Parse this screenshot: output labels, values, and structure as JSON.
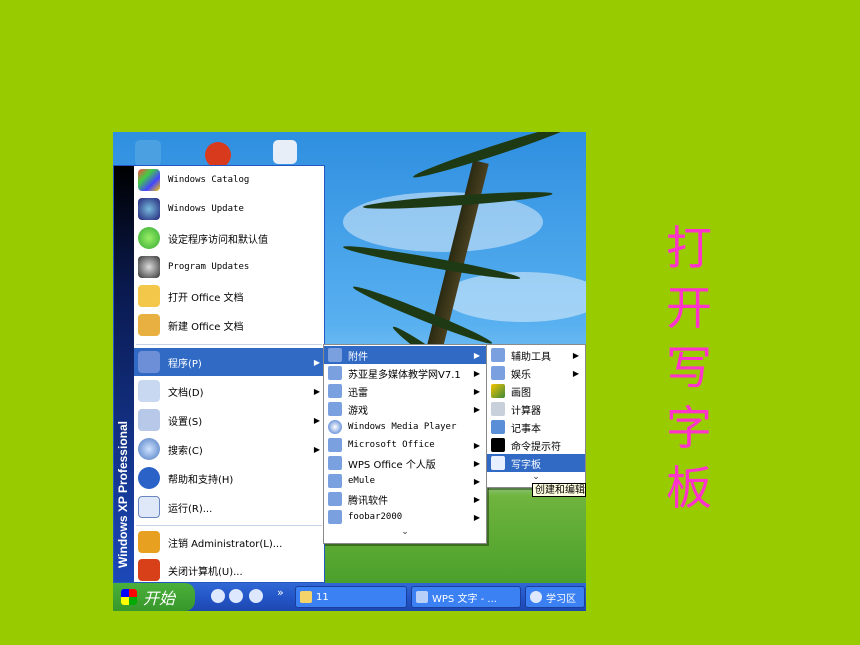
{
  "side_title_chars": [
    "打",
    "开",
    "写",
    "字",
    "板"
  ],
  "start_menu": {
    "band_text": "Windows XP Professional",
    "pinned": [
      {
        "label": "Windows Catalog",
        "icon": "windows-catalog-icon"
      },
      {
        "label": "Windows Update",
        "icon": "windows-update-icon"
      },
      {
        "label": "设定程序访问和默认值",
        "icon": "program-access-icon"
      },
      {
        "label": "Program Updates",
        "icon": "program-updates-icon"
      },
      {
        "label": "打开 Office 文档",
        "icon": "open-office-doc-icon"
      },
      {
        "label": "新建 Office 文档",
        "icon": "new-office-doc-icon"
      }
    ],
    "main": [
      {
        "label": "程序(P)",
        "icon": "programs-icon",
        "arrow": "▶"
      },
      {
        "label": "文档(D)",
        "icon": "documents-icon",
        "arrow": "▶"
      },
      {
        "label": "设置(S)",
        "icon": "settings-icon",
        "arrow": "▶"
      },
      {
        "label": "搜索(C)",
        "icon": "search-icon",
        "arrow": "▶"
      },
      {
        "label": "帮助和支持(H)",
        "icon": "help-icon",
        "arrow": ""
      },
      {
        "label": "运行(R)...",
        "icon": "run-icon",
        "arrow": ""
      }
    ],
    "bottom": [
      {
        "label": "注销 Administrator(L)...",
        "icon": "logoff-icon"
      },
      {
        "label": "关闭计算机(U)...",
        "icon": "shutdown-icon"
      }
    ]
  },
  "programs_menu": {
    "items": [
      {
        "label": "附件",
        "arrow": "▶"
      },
      {
        "label": "苏亚星多媒体教学网V7.1",
        "arrow": "▶"
      },
      {
        "label": "迅雷",
        "arrow": "▶"
      },
      {
        "label": "游戏",
        "arrow": "▶"
      },
      {
        "label": "Windows Media Player",
        "arrow": ""
      },
      {
        "label": "Microsoft Office",
        "arrow": "▶"
      },
      {
        "label": "WPS Office 个人版",
        "arrow": "▶"
      },
      {
        "label": "eMule",
        "arrow": "▶"
      },
      {
        "label": "腾讯软件",
        "arrow": "▶"
      },
      {
        "label": "foobar2000",
        "arrow": "▶"
      }
    ],
    "more": "⌄"
  },
  "accessories_menu": {
    "items": [
      {
        "label": "辅助工具",
        "arrow": "▶"
      },
      {
        "label": "娱乐",
        "arrow": "▶"
      },
      {
        "label": "画图",
        "arrow": ""
      },
      {
        "label": "计算器",
        "arrow": ""
      },
      {
        "label": "记事本",
        "arrow": ""
      },
      {
        "label": "命令提示符",
        "arrow": ""
      },
      {
        "label": "写字板",
        "arrow": ""
      }
    ],
    "more": "⌄"
  },
  "tooltip": "创建和编辑",
  "taskbar": {
    "start_label": "开始",
    "quicklaunch_more": "»",
    "buttons": [
      {
        "label": "11"
      },
      {
        "label": "WPS 文字 - ..."
      },
      {
        "label": "学习区"
      }
    ]
  },
  "colors": {
    "background": "#99cc00",
    "side_title": "#ff33cc",
    "highlight": "#316ac5",
    "taskbar": "#2456c8",
    "start_button": "#37972b"
  }
}
